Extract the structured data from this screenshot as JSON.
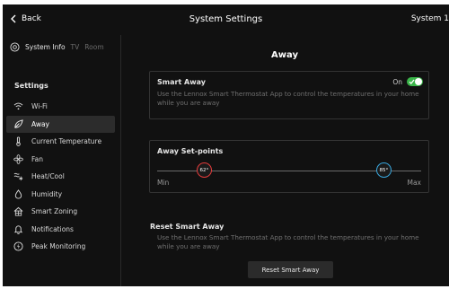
{
  "header": {
    "back_label": "Back",
    "title": "System Settings",
    "system_name": "System 1"
  },
  "sidebar": {
    "system_tabs": [
      "System Info",
      "TV",
      "Room"
    ],
    "settings_heading": "Settings",
    "items": [
      {
        "label": "Wi-Fi",
        "icon": "wifi-icon",
        "active": false
      },
      {
        "label": "Away",
        "icon": "leaf-icon",
        "active": true
      },
      {
        "label": "Current Temperature",
        "icon": "thermometer-icon",
        "active": false
      },
      {
        "label": "Fan",
        "icon": "fan-icon",
        "active": false
      },
      {
        "label": "Heat/Cool",
        "icon": "heat-cool-icon",
        "active": false
      },
      {
        "label": "Humidity",
        "icon": "droplet-icon",
        "active": false
      },
      {
        "label": "Smart Zoning",
        "icon": "zoning-icon",
        "active": false
      },
      {
        "label": "Notifications",
        "icon": "bell-icon",
        "active": false
      },
      {
        "label": "Peak Monitoring",
        "icon": "lightning-icon",
        "active": false
      }
    ]
  },
  "main": {
    "section_title": "Away",
    "smart_away": {
      "label": "Smart Away",
      "state_label": "On",
      "enabled": true,
      "description": "Use the Lennox Smart Thermostat App to control the temperatures in your home while you are away"
    },
    "setpoints": {
      "label": "Away Set-points",
      "heat": {
        "value": "62°",
        "fraction": 0.18
      },
      "cool": {
        "value": "85°",
        "fraction": 0.86
      },
      "min_label": "Min",
      "max_label": "Max"
    },
    "reset": {
      "label": "Reset Smart Away",
      "description": "Use the Lennox Smart Thermostat App to control the temperatures in your home while you are away",
      "button_label": "Reset Smart Away"
    }
  },
  "colors": {
    "accent_green": "#3bb54a",
    "heat_red": "#e33b3b",
    "cool_blue": "#38a6dd",
    "background": "#111111"
  }
}
